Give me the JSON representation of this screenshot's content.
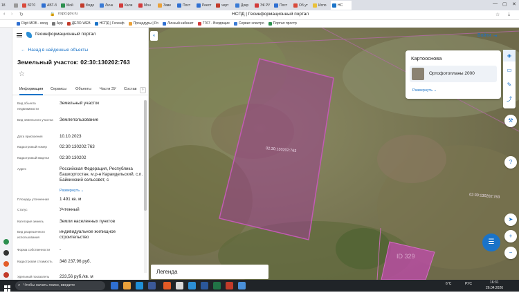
{
  "browser": {
    "tab_counter": "18",
    "tabs": [
      "8270",
      "АБТ-б",
      "Мой",
      "Федо",
      "Личн",
      "Кали",
      "Мон",
      "Заве",
      "Пост",
      "Реест",
      "черт",
      "Докр",
      "ЭК РУ",
      "Пост",
      "Об ут",
      "Испо"
    ],
    "active_tab": "НС",
    "page_title": "НСПД | Геоинформационный портал",
    "url": "nspd.gov.ru",
    "bookmarks": [
      "Digit MOБ - вход",
      "App",
      "ДЕЛО-WEB",
      "НСПД | Геоинф",
      "Процедуры | Ро",
      "Личный кабинет",
      "7767 - Входящие",
      "Сервис электро",
      "Портал простр"
    ]
  },
  "app": {
    "title": "Геоинформационный портал",
    "back_label": "Назад в найденные объекты",
    "object_title": "Земельный участок: 02:30:130202:763",
    "tabs": [
      "Информация",
      "Сервисы",
      "Объекты",
      "Части ЗУ",
      "Состав"
    ],
    "active_tab": 0,
    "fields": [
      {
        "label": "Вид объекта недвижимости",
        "value": "Земельный участок"
      },
      {
        "label": "Вид земельного участка",
        "value": "Землепользование"
      },
      {
        "label": "Дата присвоения",
        "value": "10.10.2023"
      },
      {
        "label": "Кадастровый номер",
        "value": "02:30:130202:763"
      },
      {
        "label": "Кадастровый квартал",
        "value": "02:30:130202"
      },
      {
        "label": "Адрес",
        "value": "Российская Федерация, Республика Башкортостан, м.р-н Караидельский, с.п. Байкинский сельсовет, с"
      },
      {
        "label": "Площадь уточненная",
        "value": "1 491 кв. м"
      },
      {
        "label": "Статус",
        "value": "Учтенный"
      },
      {
        "label": "Категория земель",
        "value": "Земли населенных пунктов"
      },
      {
        "label": "Вид разрешенного использования",
        "value": "индивидуальное жилищное строительство"
      },
      {
        "label": "Форма собственности",
        "value": "-"
      },
      {
        "label": "Кадастровая стоимость",
        "value": "348 237,96 руб."
      },
      {
        "label": "Удельный показатель",
        "value": "233,56 руб./кв. м"
      }
    ],
    "expand_label": "Развернуть"
  },
  "map": {
    "login_label": "Войти",
    "basemap_title": "Картооснова",
    "basemap_item": "Ортофотопланы 2000",
    "basemap_more": "Развернуть",
    "legend_label": "Легенда",
    "parcel_label": "02:30:130202:763",
    "parcel_label_2": "02:30:130202:763",
    "neighbor_label": "ID 329"
  },
  "taskbar": {
    "search_placeholder": "Чтобы начать поиск, введите",
    "weather": "6°C",
    "lang": "РУС",
    "time": "16:31",
    "date": "26.04.2026"
  }
}
